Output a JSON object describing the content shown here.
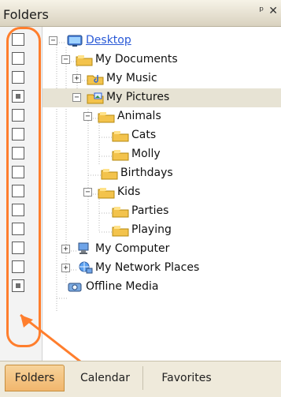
{
  "header": {
    "title": "Folders",
    "pin_icon": "pin-icon",
    "close_icon": "close-icon",
    "pin_glyph": "ᵖ",
    "close_glyph": "✕"
  },
  "tree": {
    "items": [
      {
        "label": "Desktop",
        "icon": "desktop-icon",
        "expander": "−",
        "link": true
      },
      {
        "label": "My Documents",
        "icon": "folder-icon",
        "expander": "−"
      },
      {
        "label": "My Music",
        "icon": "music-folder-icon",
        "expander": "+"
      },
      {
        "label": "My Pictures",
        "icon": "pictures-folder-icon",
        "expander": "−",
        "selected": true
      },
      {
        "label": "Animals",
        "icon": "folder-icon",
        "expander": "−"
      },
      {
        "label": "Cats",
        "icon": "folder-icon"
      },
      {
        "label": "Molly",
        "icon": "folder-icon"
      },
      {
        "label": "Birthdays",
        "icon": "folder-icon"
      },
      {
        "label": "Kids",
        "icon": "folder-icon",
        "expander": "−"
      },
      {
        "label": "Parties",
        "icon": "folder-icon"
      },
      {
        "label": "Playing",
        "icon": "folder-icon"
      },
      {
        "label": "My Computer",
        "icon": "computer-icon",
        "expander": "+"
      },
      {
        "label": "My Network Places",
        "icon": "network-icon",
        "expander": "+"
      },
      {
        "label": "Offline Media",
        "icon": "offline-media-icon"
      }
    ]
  },
  "tabs": [
    {
      "label": "Folders",
      "active": true
    },
    {
      "label": "Calendar"
    },
    {
      "label": "Favorites"
    }
  ],
  "colors": {
    "highlight": "#ff7e2d",
    "link": "#2a5ad7",
    "selected_row": "#e7e3d4"
  }
}
